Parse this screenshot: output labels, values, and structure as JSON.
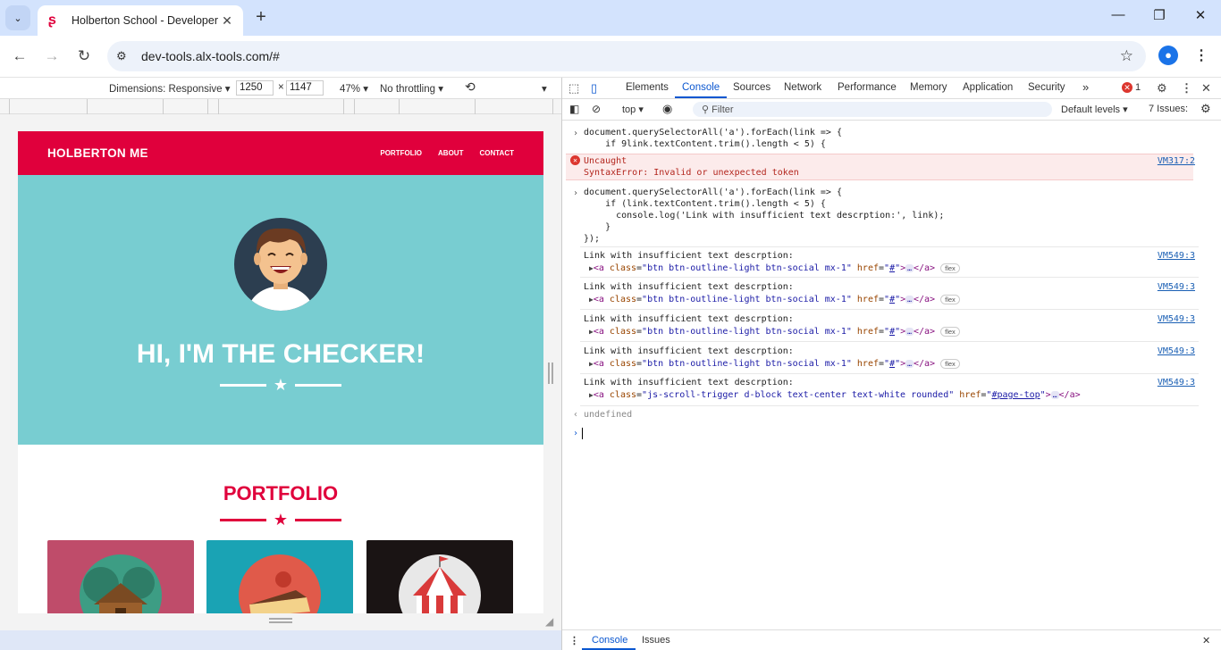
{
  "browser": {
    "tab_title": "Holberton School - Developer t",
    "url": "dev-tools.alx-tools.com/#"
  },
  "device_toolbar": {
    "dimensions_label": "Dimensions: Responsive",
    "width": "1250",
    "times": "×",
    "height": "1147",
    "zoom": "47%",
    "throttling": "No throttling"
  },
  "site": {
    "brand": "HOLBERTON ME",
    "nav": [
      "PORTFOLIO",
      "ABOUT",
      "CONTACT"
    ],
    "hero_title": "HI, I'M THE CHECKER!",
    "section_title": "PORTFOLIO",
    "colors": {
      "primary": "#e0003c",
      "hero": "#78cdd1"
    }
  },
  "devtools": {
    "tabs": [
      "Elements",
      "Console",
      "Sources",
      "Network",
      "Performance",
      "Memory",
      "Application",
      "Security"
    ],
    "active_tab": "Console",
    "more_tabs": "»",
    "error_count": "1",
    "context": "top",
    "filter_placeholder": "Filter",
    "levels": "Default levels",
    "issues": "7 Issues:",
    "drawer_tabs": [
      "Console",
      "Issues"
    ]
  },
  "console": {
    "input1_line1": "document.querySelectorAll('a').forEach(link => {",
    "input1_line2": "    if 9link.textContent.trim().length < 5) {",
    "error_title": "Uncaught",
    "error_message": "SyntaxError: Invalid or unexpected token",
    "error_source": "VM317:2",
    "input2_line1": "document.querySelectorAll('a').forEach(link => {",
    "input2_line2": "    if (link.textContent.trim().length < 5) {",
    "input2_line3": "      console.log('Link with insufficient text descrption:', link);",
    "input2_line4": "    }",
    "input2_line5": "});",
    "log_message": "Link with insufficient text descrption:",
    "log_source": "VM549:3",
    "log_class_a": "btn btn-outline-light btn-social mx-1",
    "log_href_a": "#",
    "log_class_b": "js-scroll-trigger d-block text-center text-white rounded",
    "log_href_b": "#page-top",
    "flex_badge": "flex",
    "result": "undefined"
  }
}
